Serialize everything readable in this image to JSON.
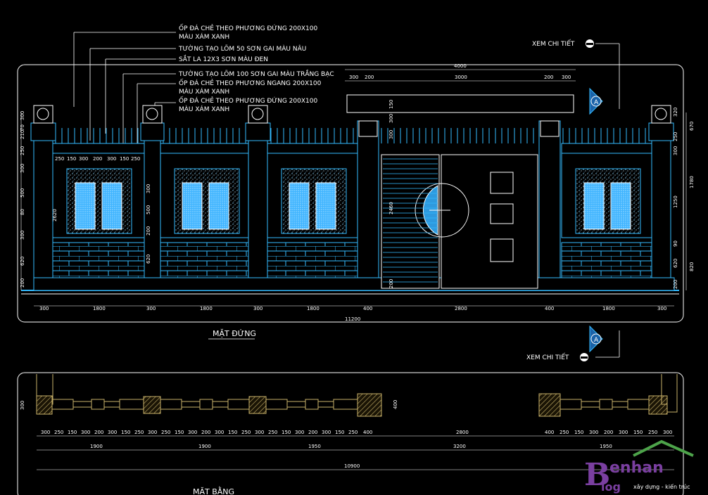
{
  "drawing": {
    "titles": {
      "elevation": "MẶT ĐỨNG",
      "plan": "MẶT BẰNG"
    },
    "annotations": [
      "ỐP ĐÁ CHẺ THEO PHƯƠNG ĐỨNG 200X100",
      "MÀU XÁM XANH",
      "TƯỜNG TẠO LÕM 50 SƠN GAI MÀU NÂU",
      "SẮT LA 12X3 SƠN MÀU ĐEN",
      "TƯỜNG TẠO LÕM 100 SƠN GAI MÀU TRẮNG BẠC",
      "ỐP ĐÁ CHẺ THEO PHƯƠNG NGANG 200X100",
      "MÀU XÁM XANH",
      "ỐP ĐÁ CHẺ THEO PHƯƠNG ĐỨNG 200X100",
      "MÀU XÁM XANH"
    ],
    "detail_callout_label": "XEM CHI TIẾT",
    "section_marker": "A",
    "elevation_dims": {
      "gate_top": [
        "4000"
      ],
      "gate_sub": [
        "300",
        "200",
        "3000",
        "200",
        "300"
      ],
      "bottom_segments": [
        "300",
        "1800",
        "300",
        "1800",
        "300",
        "1800",
        "400",
        "2800",
        "400",
        "1800",
        "300"
      ],
      "total": "11200",
      "left_vertical": [
        "300",
        "70",
        "210",
        "250",
        "300",
        "500",
        "80",
        "300",
        "620",
        "200"
      ],
      "right_vertical": [
        "320",
        "670",
        "250",
        "300",
        "1780",
        "1250",
        "90",
        "820",
        "620",
        "200"
      ],
      "panel_top": [
        "250",
        "150",
        "300",
        "200",
        "300",
        "150",
        "250"
      ],
      "panel_heights": [
        "2620",
        "300",
        "500",
        "200",
        "620"
      ],
      "gate_pillar": [
        "150",
        "300",
        "300"
      ],
      "gate_leaf_height": "2460",
      "gate_base": "200"
    },
    "plan_dims": {
      "detail_row": [
        "300",
        "250",
        "150",
        "300",
        "200",
        "300",
        "150",
        "250",
        "300",
        "250",
        "150",
        "300",
        "200",
        "300",
        "150",
        "250",
        "300",
        "250",
        "150",
        "300",
        "200",
        "300",
        "150",
        "250",
        "400",
        "2800",
        "400",
        "250",
        "150",
        "300",
        "200",
        "300",
        "150",
        "250",
        "300"
      ],
      "group_row": [
        "1900",
        "1900",
        "1950",
        "3200",
        "1950"
      ],
      "total": "10900",
      "wall_thickness": "300",
      "pillar_thickness": "400"
    },
    "logo": {
      "letter_b": "B",
      "letter_log": "log",
      "name": "enhan",
      "tagline": "xây dựng - kiến trúc"
    },
    "colors": {
      "background": "#000000",
      "primary_line": "#33bbff",
      "secondary_line": "#ffffff",
      "hatch": "#c9b26a",
      "logo": "#7a3fa0"
    }
  }
}
